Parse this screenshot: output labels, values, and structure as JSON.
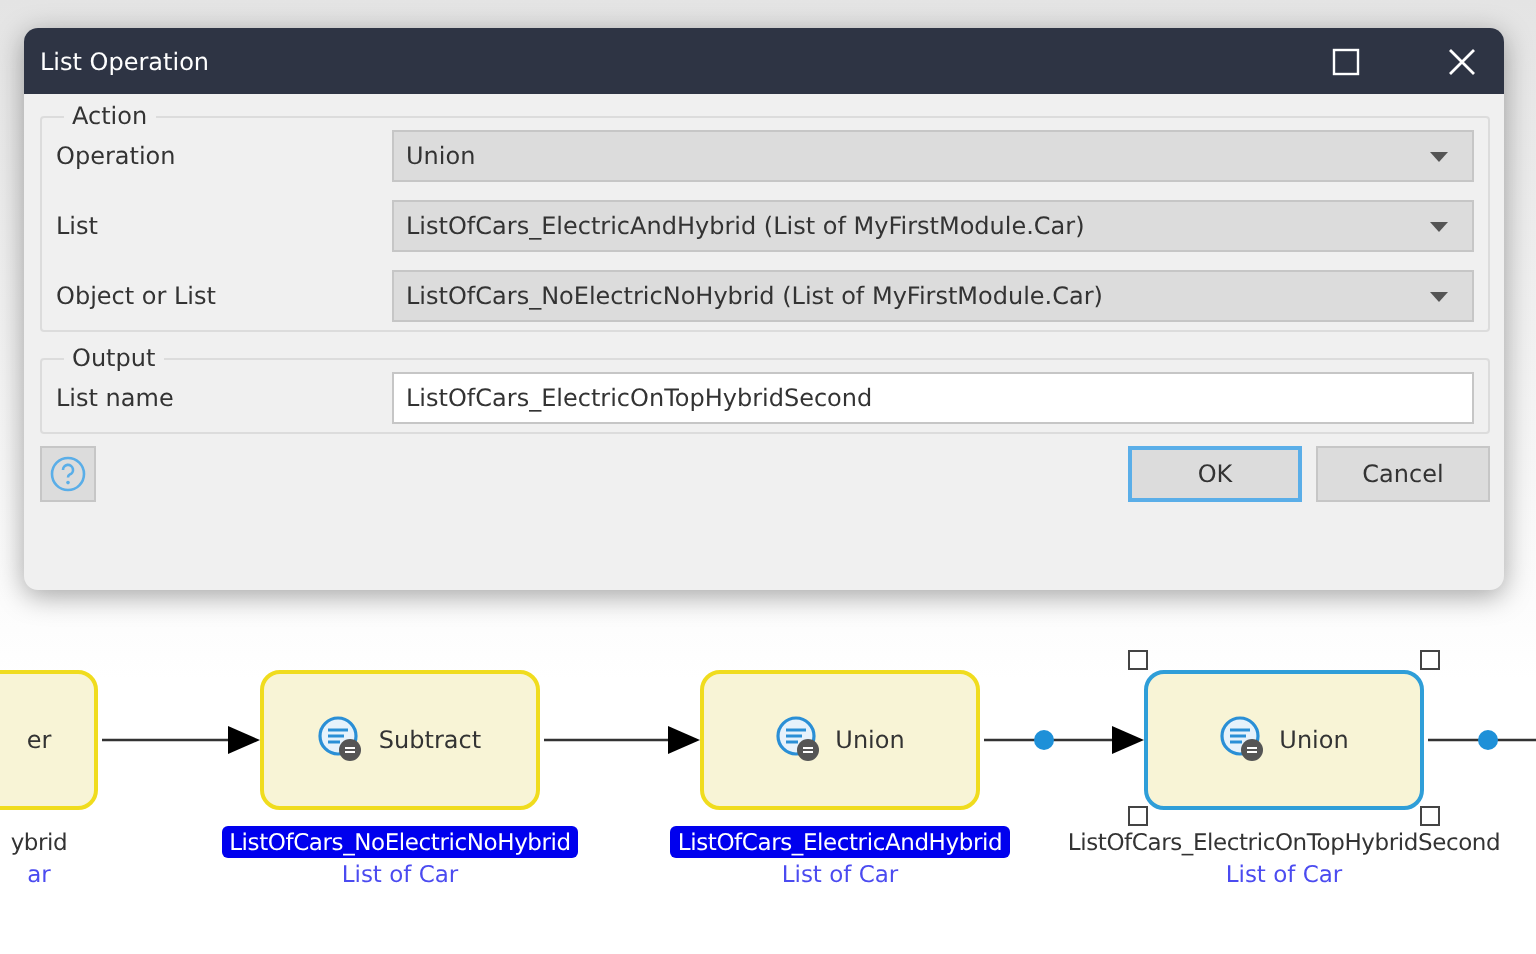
{
  "dialog": {
    "title": "List Operation",
    "groups": [
      {
        "title": "Action",
        "fields": [
          {
            "label": "Operation",
            "kind": "dropdown",
            "value": "Union"
          },
          {
            "label": "List",
            "kind": "dropdown",
            "value": "ListOfCars_ElectricAndHybrid (List of MyFirstModule.Car)"
          },
          {
            "label": "Object or List",
            "kind": "dropdown",
            "value": "ListOfCars_NoElectricNoHybrid (List of MyFirstModule.Car)"
          }
        ]
      },
      {
        "title": "Output",
        "fields": [
          {
            "label": "List name",
            "kind": "text",
            "value": "ListOfCars_ElectricOnTopHybridSecond"
          }
        ]
      }
    ],
    "buttons": [
      {
        "label": "OK",
        "selected": true
      },
      {
        "label": "Cancel",
        "selected": false
      }
    ]
  },
  "canvas": {
    "nodes": [
      {
        "label": "er",
        "icon": false,
        "selected": false,
        "variable": "ybrid",
        "highlighted": false,
        "type": "ar"
      },
      {
        "label": "Subtract",
        "icon": true,
        "selected": false,
        "variable": "ListOfCars_NoElectricNoHybrid",
        "highlighted": true,
        "type": "List of Car"
      },
      {
        "label": "Union",
        "icon": true,
        "selected": false,
        "variable": "ListOfCars_ElectricAndHybrid",
        "highlighted": true,
        "type": "List of Car"
      },
      {
        "label": "Union",
        "icon": true,
        "selected": true,
        "variable": "ListOfCars_ElectricOnTopHybridSecond",
        "highlighted": false,
        "type": "List of Car"
      }
    ],
    "edges": [
      {
        "dot": false
      },
      {
        "dot": false
      },
      {
        "dot": true
      },
      {
        "dot": true
      }
    ]
  }
}
